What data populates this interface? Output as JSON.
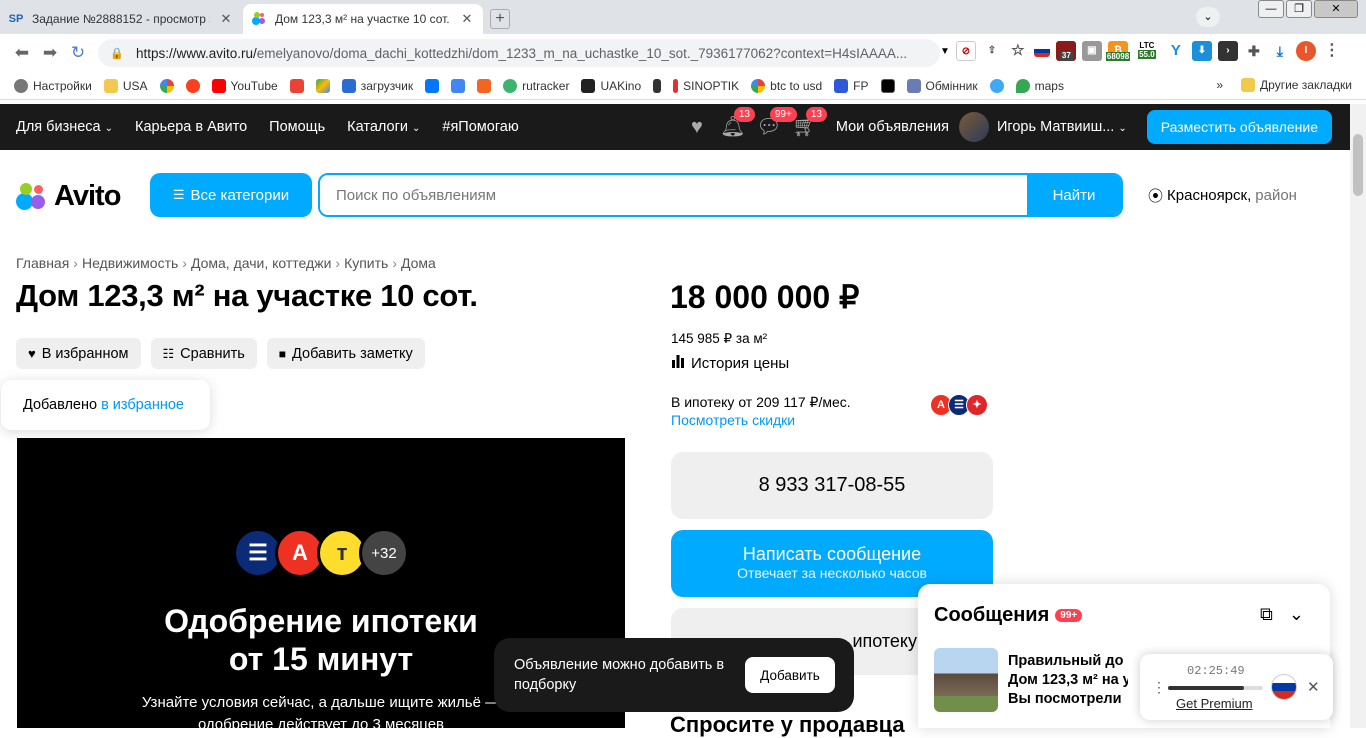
{
  "browser": {
    "tabs": [
      {
        "title": "Задание №2888152 - просмотр з",
        "favicon": "SP",
        "active": false
      },
      {
        "title": "Дом 123,3 м² на участке 10 сот. н",
        "favicon": "avito",
        "active": true
      }
    ],
    "url_main": "https://www.avito.ru/",
    "url_rest": "emelyanovo/doma_dachi_kottedzhi/dom_1233_m_na_uchastke_10_sot._7936177062?context=H4sIAAAA...",
    "ext_badges": {
      "b37": "37",
      "btc": "68098",
      "ltc_label": "LTC",
      "ltc_val": "55.0",
      "profile": "I"
    },
    "bookmarks": [
      "Настройки",
      "USA",
      "",
      "",
      "YouTube",
      "",
      "",
      "загрузчик",
      "",
      "",
      "",
      "rutracker",
      "UAKino",
      "",
      "SINOPTIK",
      "btc to usd",
      "FP",
      "",
      "Обмінник",
      "",
      "maps"
    ],
    "bookmarks_more": "»",
    "other_bookmarks": "Другие закладки"
  },
  "avito_nav": {
    "items": [
      "Для бизнеса",
      "Карьера в Авито",
      "Помощь",
      "Каталоги",
      "#яПомогаю"
    ],
    "badges": {
      "notifications": "13",
      "messages": "99+",
      "cart": "13"
    },
    "my_ads": "Мои объявления",
    "user": "Игорь Матвииш...",
    "post_ad": "Разместить объявление"
  },
  "header": {
    "logo": "Avito",
    "all_categories": "Все категории",
    "search_placeholder": "Поиск по объявлениям",
    "search_button": "Найти",
    "location_city": "Красноярск,",
    "location_area": "район"
  },
  "breadcrumbs": [
    "Главная",
    "Недвижимость",
    "Дома, дачи, коттеджи",
    "Купить",
    "Дома"
  ],
  "listing": {
    "title": "Дом 123,3 м² на участке 10 сот.",
    "actions": [
      "В избранном",
      "Сравнить",
      "Добавить заметку"
    ],
    "tooltip_text": "Добавлено",
    "tooltip_link": "в избранное"
  },
  "banner": {
    "more_banks": "+32",
    "heading_1": "Одобрение ипотеки",
    "heading_2": "от 15 минут",
    "text_1": "Узнайте условия сейчас, а дальше ищите жильё —",
    "text_2": "одобрение действует до 3 месяцев"
  },
  "sidebar": {
    "price": "18 000 000 ₽",
    "price_per_m2": "145 985 ₽ за м²",
    "price_history": "История цены",
    "mortgage_text": "В ипотеку от 209 117 ₽/мес.",
    "mortgage_link": "Посмотреть скидки",
    "phone": "8 933 317-08-55",
    "message_btn": "Написать сообщение",
    "message_sub": "Отвечает за несколько часов",
    "mortgage_btn_partial": "ипотеку",
    "ask_seller": "Спросите у продавца"
  },
  "toast": {
    "text": "Объявление можно добавить в подборку",
    "button": "Добавить"
  },
  "chat": {
    "title": "Сообщения",
    "count": "99+",
    "line1": "Правильный до",
    "line2": "Дом 123,3 м² на у",
    "line3": "Вы посмотрели"
  },
  "player": {
    "time": "02:25:49",
    "premium": "Get Premium",
    "progress": 0.8
  },
  "colors": {
    "accent": "#00aaff",
    "badge": "#ff4053",
    "dark": "#1a1a1a"
  }
}
